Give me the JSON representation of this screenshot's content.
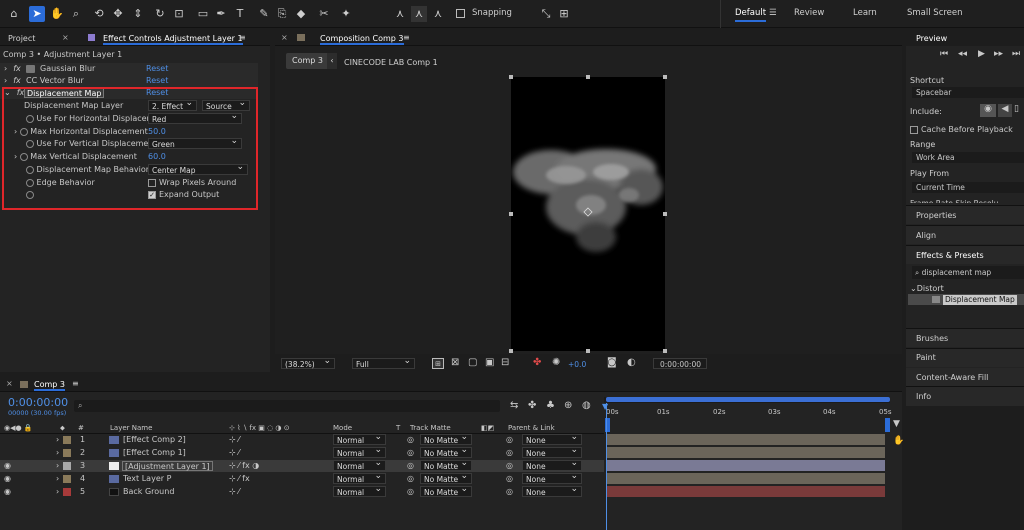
{
  "toolbar": {
    "snapping_label": "Snapping",
    "workspaces": [
      "Default",
      "Review",
      "Learn",
      "Small Screen"
    ]
  },
  "left_panel": {
    "tab_project": "Project",
    "tab_effect_controls": "Effect Controls Adjustment Layer 1",
    "breadcrumb": "Comp 3 • Adjustment Layer 1",
    "effects": [
      {
        "name": "Gaussian Blur",
        "reset": "Reset"
      },
      {
        "name": "CC Vector Blur",
        "reset": "Reset"
      },
      {
        "name": "Displacement Map",
        "reset": "Reset"
      }
    ],
    "props": {
      "map_layer_label": "Displacement Map Layer",
      "map_layer_value": "2. Effect",
      "map_layer_source": "Source",
      "use_h_label": "Use For Horizontal Displacem",
      "use_h_value": "Red",
      "max_h_label": "Max Horizontal Displacement",
      "max_h_value": "50.0",
      "use_v_label": "Use For Vertical Displacemen",
      "use_v_value": "Green",
      "max_v_label": "Max Vertical Displacement",
      "max_v_value": "60.0",
      "behavior_label": "Displacement Map Behavior",
      "behavior_value": "Center Map",
      "edge_label": "Edge Behavior",
      "wrap_label": "Wrap Pixels Around",
      "expand_label": "Expand Output"
    }
  },
  "composition": {
    "tab_label": "Composition Comp 3",
    "breadcrumb_active": "Comp 3",
    "breadcrumb_next": "CINECODE LAB Comp 1",
    "zoom": "(38.2%)",
    "resolution": "Full",
    "exposure": "+0.0",
    "timecode": "0:00:00:00"
  },
  "right_panel": {
    "preview_title": "Preview",
    "shortcut_label": "Shortcut",
    "shortcut_value": "Spacebar",
    "include_label": "Include:",
    "cache_label": "Cache Before Playback",
    "range_label": "Range",
    "range_value": "Work Area",
    "playfrom_label": "Play From",
    "playfrom_value": "Current Time",
    "cut_labels": "Frame Rate    Skip    Resolu",
    "sections": [
      "Properties",
      "Align",
      "Effects & Presets"
    ],
    "search_value": "displacement map",
    "category": "Distort",
    "result": "Displacement Map",
    "bottom_sections": [
      "Brushes",
      "Paint",
      "Content-Aware Fill",
      "Info"
    ]
  },
  "timeline": {
    "tab_label": "Comp 3",
    "timecode": "0:00:00:00",
    "fps": "00000 (30.00 fps)",
    "headers": {
      "num": "#",
      "name": "Layer Name",
      "mode": "Mode",
      "t": "T",
      "matte": "Track Matte",
      "parent": "Parent & Link"
    },
    "ruler": [
      "00s",
      "01s",
      "02s",
      "03s",
      "04s",
      "05s"
    ],
    "layers": [
      {
        "num": "1",
        "name": "[Effect Comp 2]",
        "mode": "Normal",
        "matte": "No Matte",
        "parent": "None"
      },
      {
        "num": "2",
        "name": "[Effect Comp 1]",
        "mode": "Normal",
        "matte": "No Matte",
        "parent": "None"
      },
      {
        "num": "3",
        "name": "[Adjustment Layer 1]",
        "mode": "Normal",
        "matte": "No Matte",
        "parent": "None"
      },
      {
        "num": "4",
        "name": "Text Layer P",
        "mode": "Normal",
        "matte": "No Matte",
        "parent": "None"
      },
      {
        "num": "5",
        "name": "Back Ground",
        "mode": "Normal",
        "matte": "No Matte",
        "parent": "None"
      }
    ],
    "label_colors": [
      "#8a7a5a",
      "#8a7a5a",
      "#a9a9a9",
      "#8a7a5a",
      "#a73a3a"
    ],
    "bar_colors": [
      "#6b655a",
      "#6b655a",
      "#7a7a95",
      "#6b655a",
      "#7a3a3a"
    ]
  },
  "colors": {
    "accent": "#2b6cd8",
    "highlight_border": "#e0262a",
    "link_blue": "#4f8fe6"
  }
}
